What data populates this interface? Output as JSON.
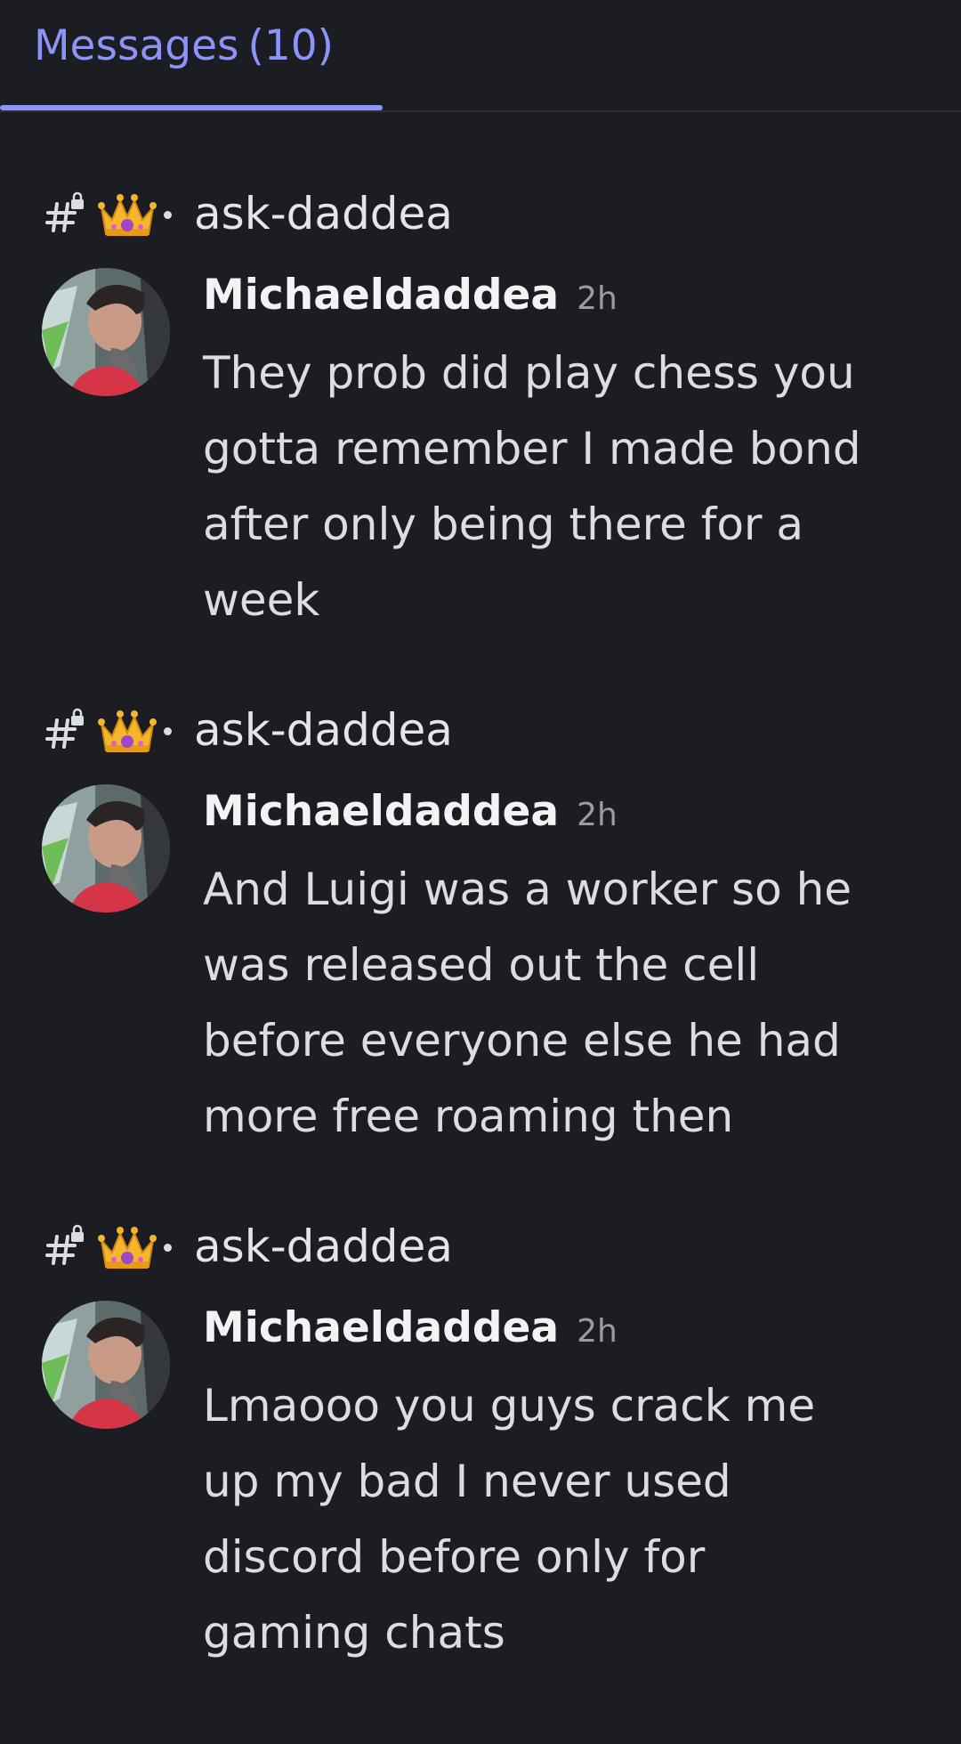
{
  "tab": {
    "label": "Messages",
    "count": "(10)"
  },
  "colors": {
    "background": "#1c1d23",
    "accent": "#8c95f7",
    "text": "#dbdee1",
    "muted": "#9a9ca3"
  },
  "results": [
    {
      "channel": "ask-daddea",
      "channel_icons": [
        "hashtag-lock-icon",
        "crown-icon"
      ],
      "author": "Michaeldaddea",
      "time": "2h",
      "lines": [
        "They prob did play chess you",
        "gotta remember I made bond",
        "after only being there for a",
        "week"
      ]
    },
    {
      "channel": "ask-daddea",
      "channel_icons": [
        "hashtag-lock-icon",
        "crown-icon"
      ],
      "author": "Michaeldaddea",
      "time": "2h",
      "lines": [
        "And Luigi was a worker so he",
        "was released out the cell",
        "before everyone else he had",
        "more free roaming then"
      ]
    },
    {
      "channel": "ask-daddea",
      "channel_icons": [
        "hashtag-lock-icon",
        "crown-icon"
      ],
      "author": "Michaeldaddea",
      "time": "2h",
      "lines": [
        "Lmaooo you guys crack me",
        "up my bad I never used",
        "discord before only for",
        "gaming chats"
      ]
    }
  ]
}
